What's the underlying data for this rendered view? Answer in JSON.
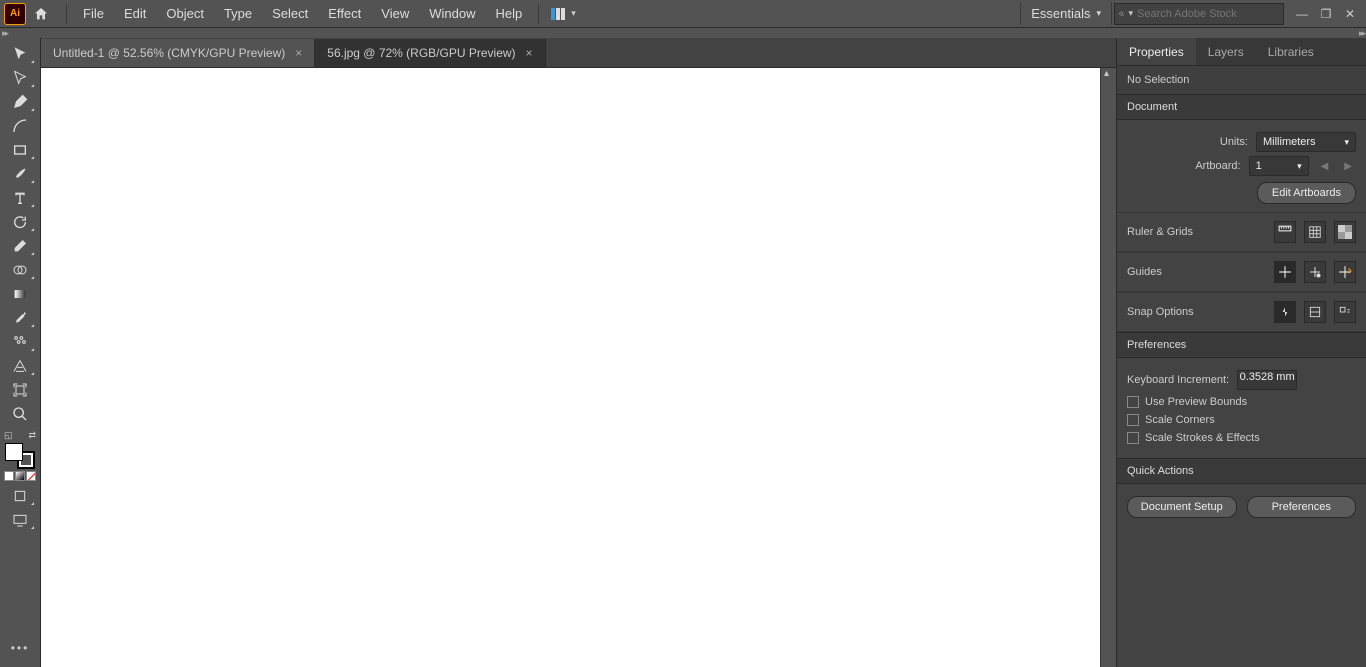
{
  "menubar": {
    "items": [
      "File",
      "Edit",
      "Object",
      "Type",
      "Select",
      "Effect",
      "View",
      "Window",
      "Help"
    ],
    "workspace": "Essentials",
    "search_placeholder": "Search Adobe Stock"
  },
  "tabs": [
    {
      "label": "Untitled-1 @ 52.56% (CMYK/GPU Preview)",
      "active": false
    },
    {
      "label": "56.jpg @ 72% (RGB/GPU Preview)",
      "active": true
    }
  ],
  "panel": {
    "tabs": [
      "Properties",
      "Layers",
      "Libraries"
    ],
    "active_tab": "Properties",
    "selection": "No Selection",
    "document": {
      "heading": "Document",
      "units_label": "Units:",
      "units_value": "Millimeters",
      "artboard_label": "Artboard:",
      "artboard_value": "1",
      "edit_artboards": "Edit Artboards"
    },
    "ruler_grids": "Ruler & Grids",
    "guides": "Guides",
    "snap_options": "Snap Options",
    "preferences": {
      "heading": "Preferences",
      "keyboard_increment_label": "Keyboard Increment:",
      "keyboard_increment_value": "0.3528 mm",
      "checks": [
        "Use Preview Bounds",
        "Scale Corners",
        "Scale Strokes & Effects"
      ]
    },
    "quick_actions": {
      "heading": "Quick Actions",
      "buttons": [
        "Document Setup",
        "Preferences"
      ]
    }
  }
}
